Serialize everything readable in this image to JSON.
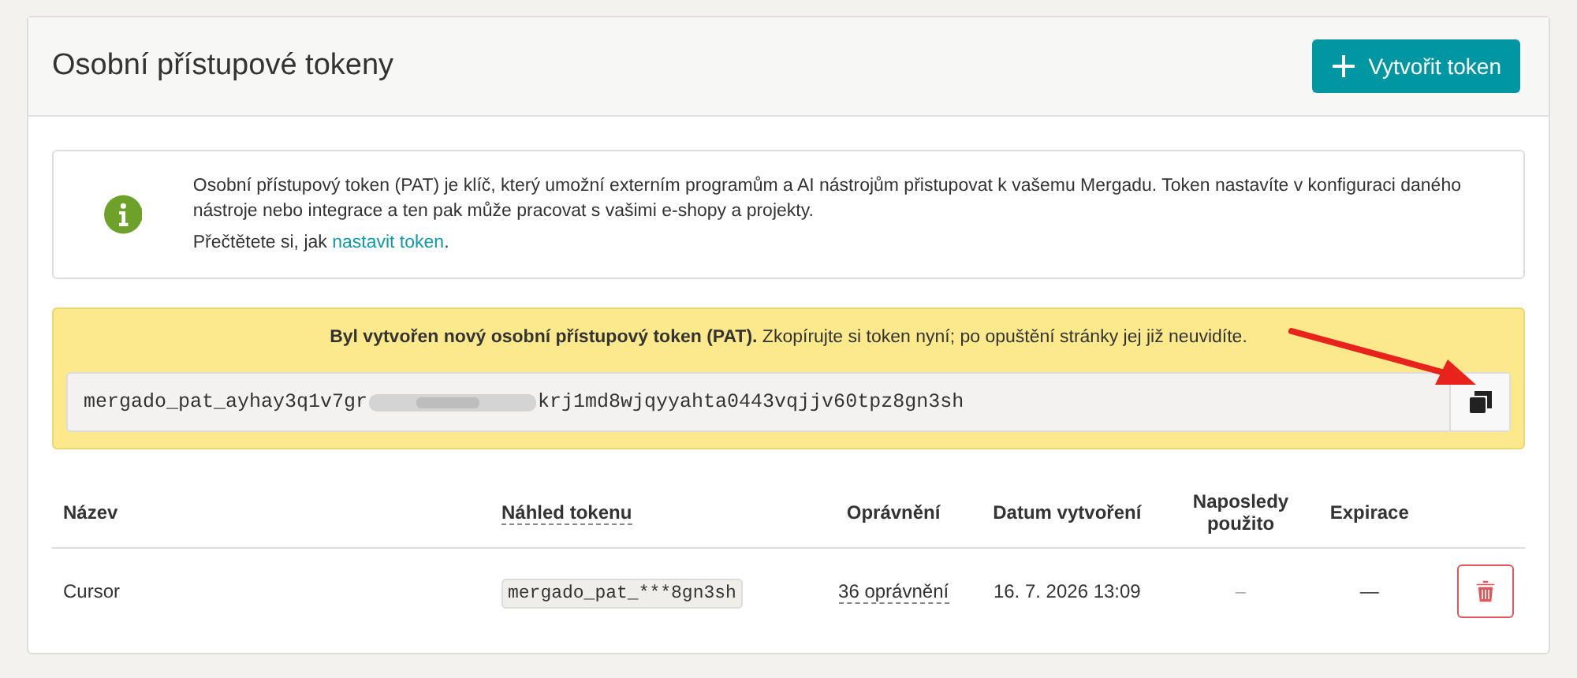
{
  "header": {
    "title": "Osobní přístupové tokeny",
    "create_button": "Vytvořit token"
  },
  "info": {
    "text": "Osobní přístupový token (PAT) je klíč, který umožní externím programům a AI nástrojům přistupovat k vašemu Mergadu. Token nastavíte v konfiguraci daného nástroje nebo integrace a ten pak může pracovat s vašimi e-shopy a projekty.",
    "read_prefix": "Přečtětete si, jak ",
    "read_link": "nastavit token",
    "read_suffix": "."
  },
  "created_notice": {
    "text": "**Byl vytvořen nový osobní přístupový token (PAT).** Zkopírujte si token nyní; po opuštění stránky jej již neuvidíte.",
    "token_start": "mergado_pat_ayhay3q1v7gr",
    "token_end": "krj1md8wjqyyahta0443vqjjv60tpz8gn3sh"
  },
  "table": {
    "columns": [
      "Název",
      "Náhled tokenu",
      "Oprávnění",
      "Datum vytvoření",
      "Naposledy použito",
      "Expirace"
    ],
    "rows": [
      {
        "name": "Cursor",
        "preview": "mergado_pat_***8gn3sh",
        "permissions": "36 oprávnění",
        "created": "16. 7. 2026 13:09",
        "last_used": "–",
        "expiration": "—"
      }
    ]
  }
}
